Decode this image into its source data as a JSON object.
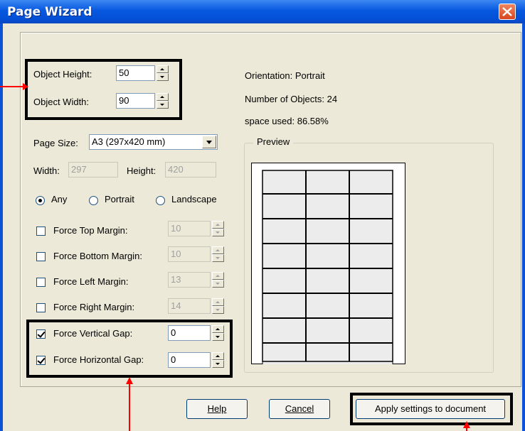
{
  "window": {
    "title": "Page Wizard"
  },
  "object_height": {
    "label": "Object Height:",
    "value": "50"
  },
  "object_width": {
    "label": "Object Width:",
    "value": "90"
  },
  "info": {
    "orientation": "Orientation: Portrait",
    "num_objects": "Number of Objects: 24",
    "space_used": "space used: 86.58%"
  },
  "page_size": {
    "label": "Page Size:",
    "value": "A3 (297x420 mm)"
  },
  "width": {
    "label": "Width:",
    "value": "297"
  },
  "height": {
    "label": "Height:",
    "value": "420"
  },
  "orientation_options": [
    {
      "label": "Any",
      "selected": true
    },
    {
      "label": "Portrait",
      "selected": false
    },
    {
      "label": "Landscape",
      "selected": false
    }
  ],
  "force_options": [
    {
      "label": "Force Top Margin:",
      "checked": false,
      "value": "10",
      "enabled": false
    },
    {
      "label": "Force Bottom Margin:",
      "checked": false,
      "value": "10",
      "enabled": false
    },
    {
      "label": "Force Left Margin:",
      "checked": false,
      "value": "13",
      "enabled": false
    },
    {
      "label": "Force Right Margin:",
      "checked": false,
      "value": "14",
      "enabled": false
    },
    {
      "label": "Force Vertical Gap:",
      "checked": true,
      "value": "0",
      "enabled": true
    },
    {
      "label": "Force Horizontal Gap:",
      "checked": true,
      "value": "0",
      "enabled": true
    }
  ],
  "preview": {
    "title": "Preview",
    "rows": 8,
    "cols": 3
  },
  "buttons": {
    "help": "Help",
    "cancel": "Cancel",
    "apply": "Apply settings to document"
  },
  "colors": {
    "titlebar": "#0758e0",
    "dialog_bg": "#ece9d8",
    "annotation_arrow": "#ff0000"
  }
}
